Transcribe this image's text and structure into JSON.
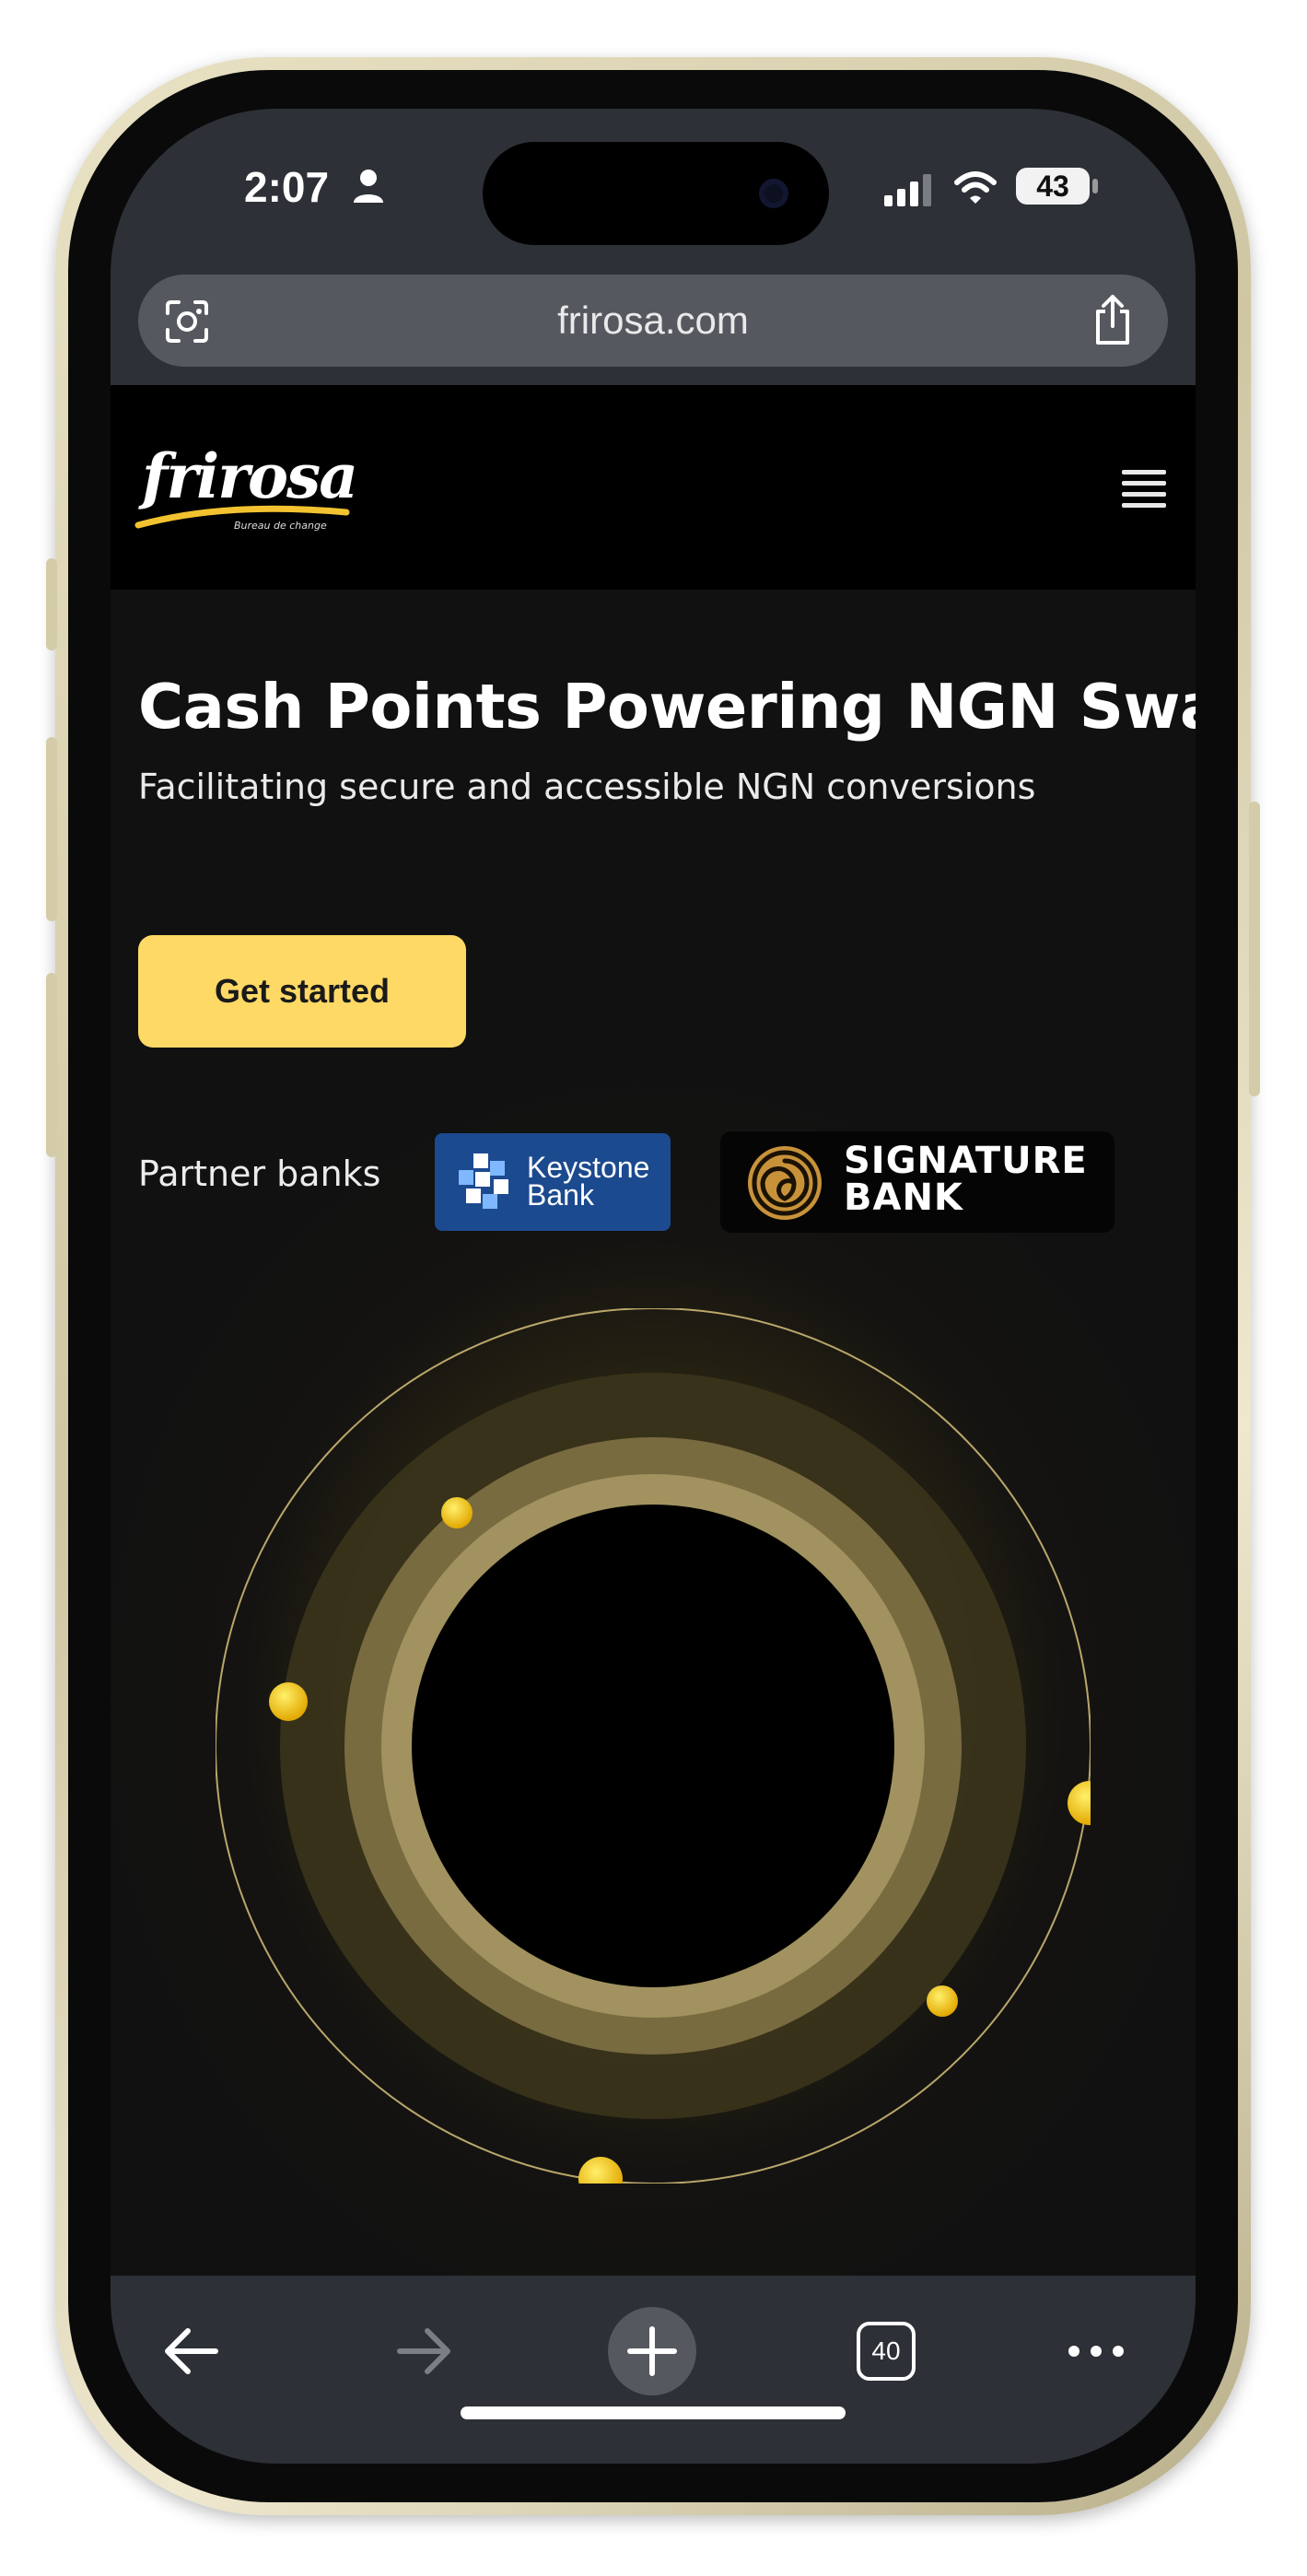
{
  "status_bar": {
    "time": "2:07",
    "battery": "43"
  },
  "browser": {
    "url": "frirosa.com",
    "tab_count": "40"
  },
  "site": {
    "logo_text": "frirosa",
    "logo_tagline": "Bureau de change",
    "hero_title": "Cash Points Powering NGN Swaps",
    "hero_subtitle": "Facilitating secure and accessible NGN conversions",
    "cta_label": "Get started",
    "partners_label": "Partner banks",
    "partners": [
      {
        "name_line1": "Keystone",
        "name_line2": "Bank"
      },
      {
        "name_line1": "SIGNATURE",
        "name_line2": "BANK"
      }
    ]
  },
  "colors": {
    "accent_yellow": "#ffd965",
    "chrome_gray": "#2d3036",
    "keystone_blue": "#1c4a8f"
  },
  "icons": [
    "person-icon",
    "signal-icon",
    "wifi-icon",
    "lens-icon",
    "share-icon",
    "hamburger-icon",
    "back-arrow-icon",
    "forward-arrow-icon",
    "plus-icon",
    "more-icon"
  ]
}
